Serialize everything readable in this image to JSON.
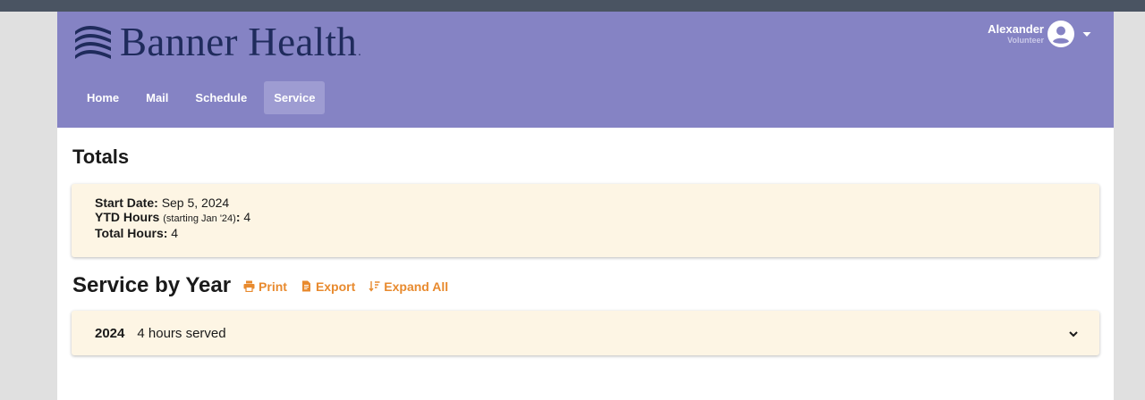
{
  "header": {
    "brand": "Banner Health",
    "brand_mark": ".",
    "user": {
      "name": "Alexander",
      "role": "Volunteer"
    },
    "nav": [
      {
        "label": "Home"
      },
      {
        "label": "Mail"
      },
      {
        "label": "Schedule"
      },
      {
        "label": "Service",
        "active": true
      }
    ]
  },
  "totals": {
    "title": "Totals",
    "start_date_label": "Start Date:",
    "start_date_value": "Sep 5, 2024",
    "ytd_label": "YTD Hours",
    "ytd_note": "(starting Jan '24)",
    "ytd_colon": ":",
    "ytd_value": "4",
    "total_label": "Total Hours:",
    "total_value": "4"
  },
  "service": {
    "title": "Service by Year",
    "actions": {
      "print": "Print",
      "export": "Export",
      "expand_all": "Expand All"
    },
    "years": [
      {
        "year": "2024",
        "summary": "4 hours served"
      }
    ]
  },
  "colors": {
    "header_bg": "#8583c4",
    "nav_active_bg": "#9e9cd2",
    "card_bg": "#fdf5e4",
    "accent": "#e88a2e",
    "logo": "#1f2b5c",
    "topbar": "#4a5462"
  },
  "icons": {
    "logo": "banner-waves-icon",
    "avatar": "account-circle-icon",
    "user_menu": "caret-down-icon",
    "print": "printer-icon",
    "export": "file-export-icon",
    "expand_all": "sort-expand-icon",
    "year_toggle": "chevron-down-icon"
  }
}
